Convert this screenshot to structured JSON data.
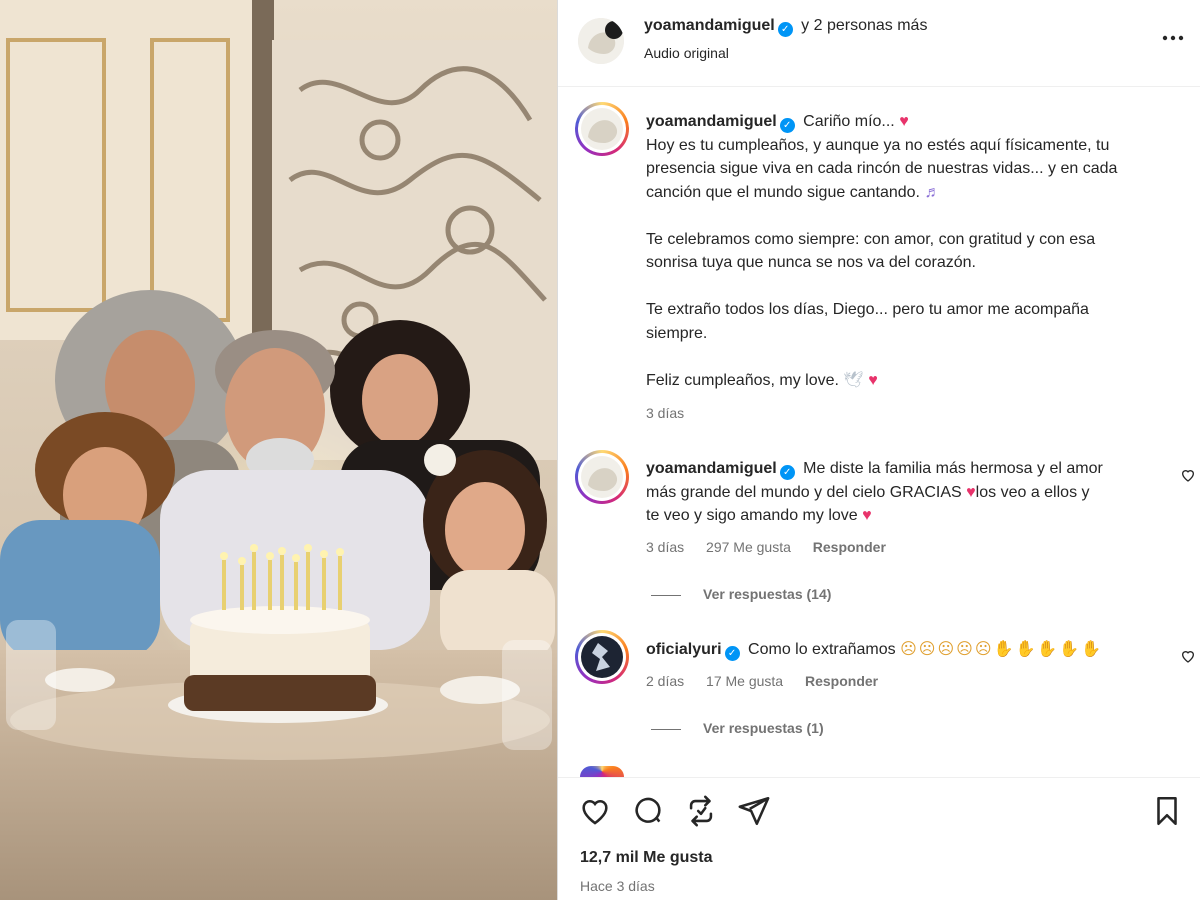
{
  "post": {
    "author": "yoamandamiguel",
    "coauthors_text": "y 2 personas más",
    "audio": "Audio original",
    "more_options": "..."
  },
  "caption": {
    "username": "yoamandamiguel",
    "lines": [
      "Cariño mío...",
      "Hoy es tu cumpleaños, y aunque ya no estés aquí físicamente, tu",
      "presencia sigue viva en cada rincón de nuestras vidas... y en cada",
      "canción que el mundo sigue cantando.",
      "Te celebramos como siempre: con amor, con gratitud y con esa",
      "sonrisa tuya que nunca se nos va del corazón.",
      "Te extraño todos los días, Diego... pero tu amor me acompaña",
      "siempre.",
      "Feliz cumpleaños, my love."
    ],
    "time": "3 días"
  },
  "comments": [
    {
      "username": "yoamandamiguel",
      "lines": [
        "Me diste la familia más hermosa y el amor",
        "más grande del mundo y del cielo GRACIAS",
        "los veo a ellos y",
        "te veo y sigo amando my love"
      ],
      "time": "3 días",
      "likes": "297 Me gusta",
      "reply": "Responder",
      "view_replies": "Ver respuestas (14)"
    },
    {
      "username": "oficialyuri",
      "text": "Como lo extrañamos",
      "time": "2 días",
      "likes": "17 Me gusta",
      "reply": "Responder",
      "view_replies": "Ver respuestas (1)"
    }
  ],
  "footer": {
    "likes": "12,7 mil Me gusta",
    "posted": "Hace 3 días"
  },
  "icons": [
    "heart-icon",
    "comment-icon",
    "repost-icon",
    "share-icon",
    "bookmark-icon",
    "more-icon",
    "verified-icon"
  ],
  "colors": {
    "verified": "#0095f6",
    "heart_emoji": "#e8336b",
    "text": "#262626",
    "muted": "#737373"
  }
}
